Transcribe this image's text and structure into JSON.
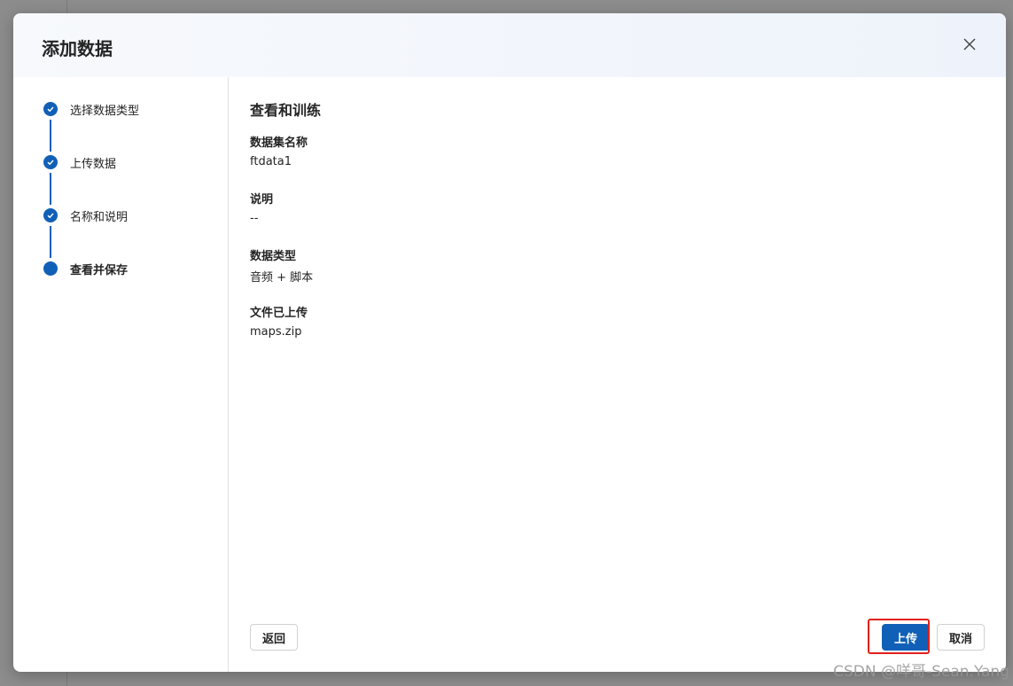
{
  "dialog": {
    "title": "添加数据",
    "close_icon": "close-icon"
  },
  "steps": [
    {
      "label": "选择数据类型",
      "status": "completed"
    },
    {
      "label": "上传数据",
      "status": "completed"
    },
    {
      "label": "名称和说明",
      "status": "completed"
    },
    {
      "label": "查看并保存",
      "status": "current"
    }
  ],
  "review": {
    "title": "查看和训练",
    "fields": [
      {
        "label": "数据集名称",
        "value": "ftdata1"
      },
      {
        "label": "说明",
        "value": "--"
      },
      {
        "label": "数据类型",
        "value": "音频 + 脚本"
      },
      {
        "label": "文件已上传",
        "value": "maps.zip"
      }
    ]
  },
  "footer": {
    "back_label": "返回",
    "upload_label": "上传",
    "cancel_label": "取消"
  },
  "watermark": "CSDN @咩哥-Sean.Yang",
  "colors": {
    "accent": "#1160b7",
    "highlight": "#e0201b"
  }
}
